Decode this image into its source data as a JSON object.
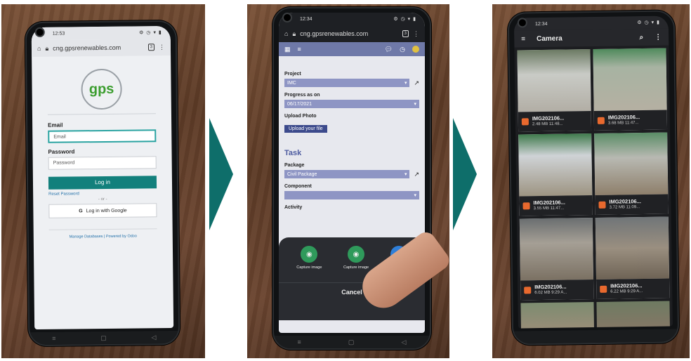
{
  "phone1": {
    "time": "12:53",
    "url": "cng.gpsrenewables.com",
    "tab_count": "3",
    "logo_text": "gps",
    "email_label": "Email",
    "email_placeholder": "Email",
    "password_label": "Password",
    "password_placeholder": "Password",
    "login_button": "Log in",
    "reset_link": "Reset Password",
    "or_text": "- or -",
    "google_button": "Log in with Google",
    "footer_manage": "Manage Databases",
    "footer_powered": "Powered by Odoo"
  },
  "phone2": {
    "time": "12:34",
    "url": "cng.gpsrenewables.com",
    "tab_count": "3",
    "project_label": "Project",
    "project_value": "IMC",
    "progress_label": "Progress as on",
    "progress_value": "06/17/2021",
    "upload_label": "Upload Photo",
    "upload_button": "Upload your file",
    "task_title": "Task",
    "package_label": "Package",
    "package_value": "Civil Package",
    "component_label": "Component",
    "component_value": "",
    "activity_label": "Activity",
    "share_items": [
      {
        "label": "Capture image",
        "color": "#2f9a5b"
      },
      {
        "label": "Capture image",
        "color": "#2f9a5b"
      },
      {
        "label": "Fi",
        "color": "#2f7fd8"
      }
    ],
    "cancel_label": "Cancel"
  },
  "phone3": {
    "time": "12:34",
    "title": "Camera",
    "photos": [
      {
        "name": "IMG202106...",
        "meta": "2.48 MB 11:48..."
      },
      {
        "name": "IMG202106...",
        "meta": "3.68 MB 11:47..."
      },
      {
        "name": "IMG202106...",
        "meta": "3.55 MB 11:47..."
      },
      {
        "name": "IMG202106...",
        "meta": "3.72 MB 11:09..."
      },
      {
        "name": "IMG202106...",
        "meta": "6.02 MB 9:29 A..."
      },
      {
        "name": "IMG202106...",
        "meta": "6.22 MB 9:29 A..."
      }
    ]
  },
  "colors": {
    "arrow": "#0e6e6a",
    "brand_teal": "#12807c",
    "form_purple": "#6f79a8",
    "thumb_icon": "#e8692e"
  }
}
